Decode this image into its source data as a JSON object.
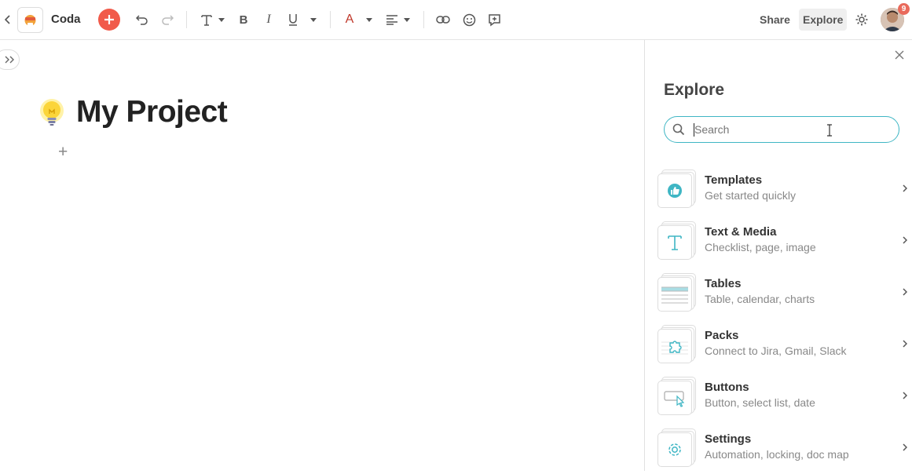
{
  "app": {
    "name": "Coda"
  },
  "toolbar": {
    "share_label": "Share",
    "explore_label": "Explore",
    "notification_count": "9"
  },
  "doc": {
    "title": "My Project",
    "add_symbol": "+"
  },
  "explore": {
    "heading": "Explore",
    "search_placeholder": "Search",
    "items": [
      {
        "title": "Templates",
        "subtitle": "Get started quickly",
        "icon": "thumbs-up-icon"
      },
      {
        "title": "Text & Media",
        "subtitle": "Checklist, page, image",
        "icon": "text-t-icon"
      },
      {
        "title": "Tables",
        "subtitle": "Table, calendar, charts",
        "icon": "table-icon"
      },
      {
        "title": "Packs",
        "subtitle": "Connect to Jira, Gmail, Slack",
        "icon": "puzzle-icon"
      },
      {
        "title": "Buttons",
        "subtitle": "Button, select list, date",
        "icon": "button-cursor-icon"
      },
      {
        "title": "Settings",
        "subtitle": "Automation, locking, doc map",
        "icon": "gear-icon"
      }
    ]
  },
  "colors": {
    "accent": "#3fb6c4",
    "add_button": "#f15a4a",
    "text_color_a": "#c0392b",
    "badge": "#e96a5b"
  }
}
